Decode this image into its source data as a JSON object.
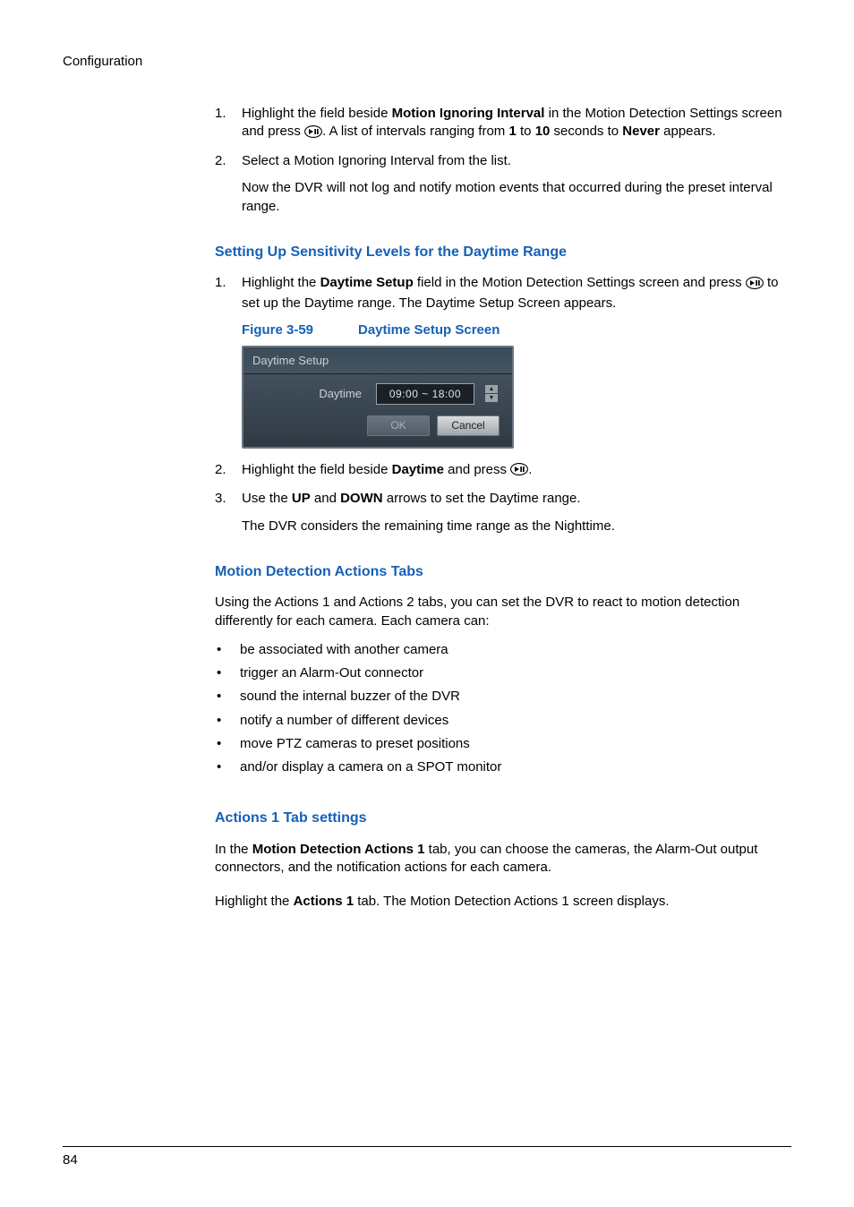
{
  "header": "Configuration",
  "step1": {
    "num": "1.",
    "part1": "Highlight the field beside ",
    "bold1": "Motion Ignoring Interval",
    "part2": " in the Motion Detection Settings screen and press ",
    "part3": ". A list of intervals ranging from ",
    "bold2": "1",
    "part4": " to ",
    "bold3": "10",
    "part5": " seconds to ",
    "bold4": "Never",
    "part6": " appears."
  },
  "step2": {
    "num": "2.",
    "text": "Select a Motion Ignoring Interval from the list.",
    "note": "Now the DVR will not log and notify motion events that occurred during the preset interval range."
  },
  "section_sensitivity": {
    "title": "Setting Up Sensitivity Levels for the Daytime Range",
    "step1": {
      "num": "1.",
      "part1": "Highlight the ",
      "bold1": "Daytime Setup",
      "part2": " field in the Motion Detection Settings screen and press ",
      "part3": " to set up the Daytime range. The Daytime Setup Screen appears."
    },
    "figure": {
      "num": "Figure 3-59",
      "title": "Daytime Setup Screen",
      "panel_title": "Daytime Setup",
      "label": "Daytime",
      "time": "09:00 ~ 18:00",
      "ok": "OK",
      "cancel": "Cancel"
    },
    "step2": {
      "num": "2.",
      "part1": "Highlight the field beside ",
      "bold1": "Daytime",
      "part2": " and press ",
      "part3": "."
    },
    "step3": {
      "num": "3.",
      "part1": "Use the ",
      "bold1": "UP",
      "part2": " and ",
      "bold2": "DOWN",
      "part3": " arrows to set the Daytime range.",
      "note": "The DVR considers the remaining time range as the Nighttime."
    }
  },
  "section_motion": {
    "title": "Motion Detection Actions Tabs",
    "intro": "Using the Actions 1 and Actions 2 tabs, you can set the DVR to react to motion detection differently for each camera. Each camera can:",
    "bullets": [
      "be associated with another camera",
      "trigger an Alarm-Out connector",
      "sound the internal buzzer of the DVR",
      "notify a number of different devices",
      "move PTZ cameras to preset positions",
      "and/or display a camera on a SPOT monitor"
    ]
  },
  "section_actions1": {
    "title": "Actions 1 Tab settings",
    "p1_a": "In the ",
    "p1_bold": "Motion Detection Actions 1",
    "p1_b": " tab, you can choose the cameras, the Alarm-Out output connectors, and the notification actions for each camera.",
    "p2_a": "Highlight the ",
    "p2_bold": "Actions 1",
    "p2_b": " tab. The Motion Detection Actions 1 screen displays."
  },
  "page_number": "84",
  "bullet_char": "•"
}
